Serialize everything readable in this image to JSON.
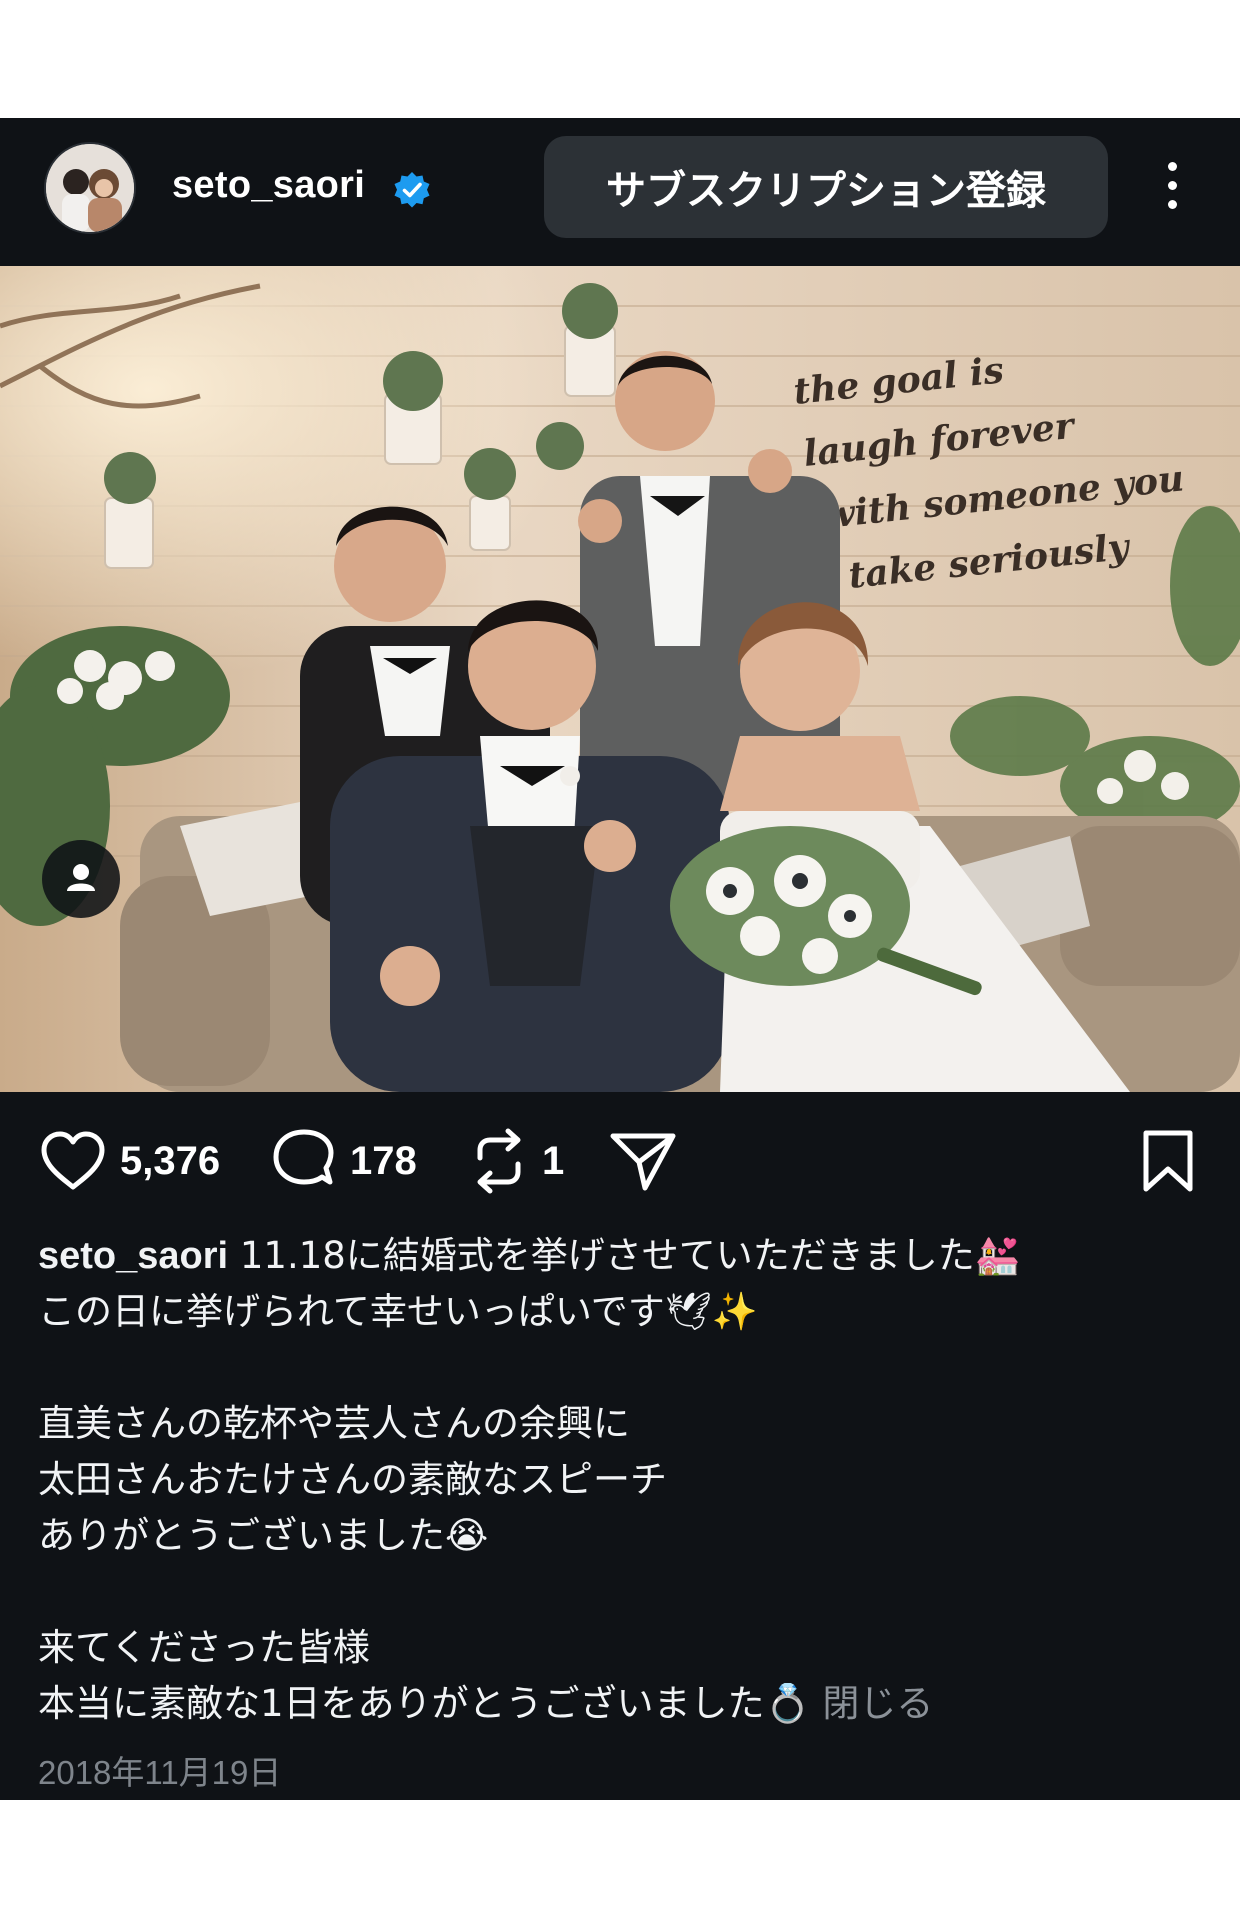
{
  "header": {
    "username": "seto_saori",
    "subscribe_label": "サブスクリプション登録"
  },
  "photo": {
    "wall_script": [
      "the goal is",
      "laugh forever",
      "with someone you",
      "take seriously"
    ]
  },
  "actions": {
    "likes": "5,376",
    "comments": "178",
    "reposts": "1"
  },
  "caption": {
    "username": "seto_saori",
    "lines": [
      "11.18に結婚式を挙げさせていただきました💒",
      "この日に挙げられて幸せいっぱいです🕊✨",
      "",
      "直美さんの乾杯や芸人さんの余興に",
      "太田さんおたけさんの素敵なスピーチ",
      "ありがとうございました😭",
      "",
      "来てくださった皆様",
      "本当に素敵な1日をありがとうございました💍"
    ],
    "close_label": "閉じる"
  },
  "date": "2018年11月19日",
  "colors": {
    "background": "#0f1216",
    "button": "#2c3136",
    "verified": "#1d9bf0",
    "muted": "#7e848b"
  },
  "icons": [
    "verified-badge-icon",
    "more-options-icon",
    "heart-icon",
    "comment-icon",
    "repost-icon",
    "share-icon",
    "bookmark-icon",
    "user-tag-icon"
  ]
}
